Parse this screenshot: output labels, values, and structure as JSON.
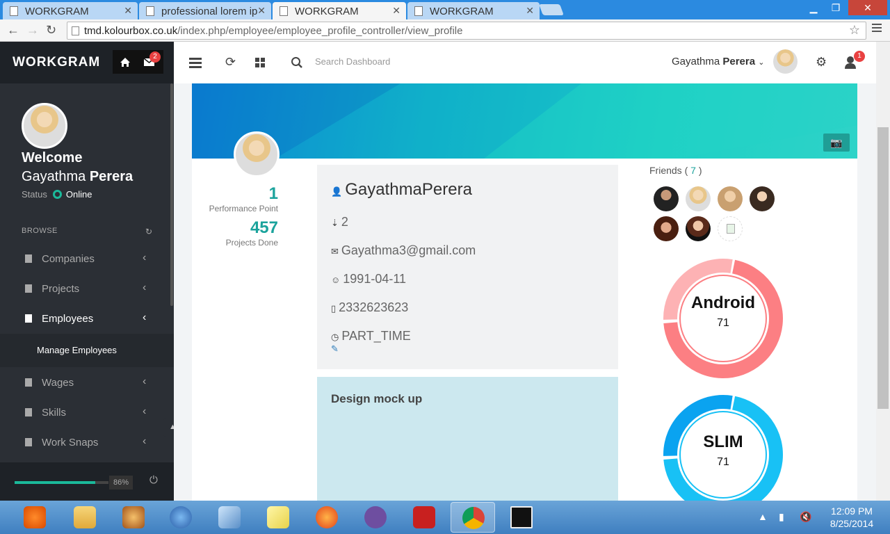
{
  "browser": {
    "tabs": [
      {
        "label": "WORKGRAM"
      },
      {
        "label": "professional lorem ip"
      },
      {
        "label": "WORKGRAM"
      },
      {
        "label": "WORKGRAM"
      }
    ],
    "url_host": "tmd.kolourbox.co.uk",
    "url_path": "/index.php/employee/employee_profile_controller/view_profile"
  },
  "sidebar": {
    "brand": "WORKGRAM",
    "mail_badge": "2",
    "welcome": "Welcome",
    "first_name": "Gayathma",
    "last_name": "Perera",
    "status_label": "Status",
    "status_value": "Online",
    "browse_label": "BROWSE",
    "items": [
      {
        "label": "Companies"
      },
      {
        "label": "Projects"
      },
      {
        "label": "Employees"
      },
      {
        "label": "Wages"
      },
      {
        "label": "Skills"
      },
      {
        "label": "Work Snaps"
      }
    ],
    "submenu_item": "Manage Employees",
    "progress_percent": 86,
    "progress_label": "86%",
    "status_color": "#1bb99a"
  },
  "topbar": {
    "search_placeholder": "Search Dashboard",
    "user_first": "Gayathma",
    "user_last": "Perera",
    "notif_badge": "1"
  },
  "profile": {
    "performance_value": "1",
    "performance_label": "Performance Point",
    "projects_value": "457",
    "projects_label": "Projects Done",
    "name": "GayathmaPerera",
    "rank": "2",
    "email": "Gayathma3@gmail.com",
    "birthday": "1991-04-11",
    "phone": "2332623623",
    "employment": "PART_TIME",
    "project_title": "Design mock up",
    "friends_label": "Friends",
    "friends_count": "7",
    "skills": [
      {
        "name": "Android",
        "value": "71",
        "colors": [
          "#fc7f83",
          "#fdb2b4"
        ]
      },
      {
        "name": "SLIM",
        "value": "71",
        "colors": [
          "#18c1f5",
          "#0aa3f0"
        ]
      }
    ],
    "accent": "#1ba39c"
  },
  "taskbar": {
    "apps": [
      "windows-media-center",
      "file-explorer",
      "media-player",
      "infinity-app",
      "virtualbox",
      "sticky-notes",
      "firefox",
      "github",
      "filezilla",
      "chrome",
      "dreamweaver"
    ],
    "time": "12:09 PM",
    "date": "8/25/2014"
  }
}
